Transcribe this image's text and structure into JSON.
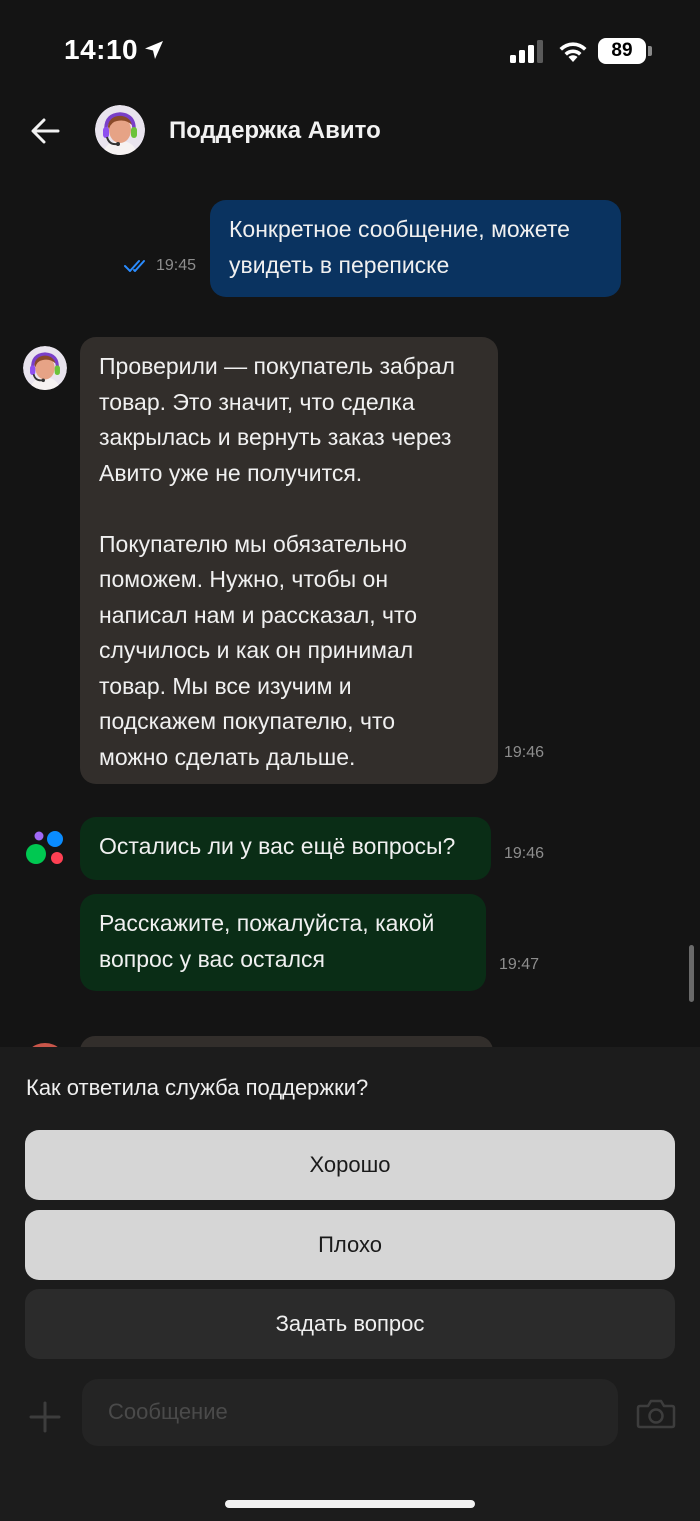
{
  "status_bar": {
    "time": "14:10",
    "battery": "89",
    "icons": [
      "location-arrow-icon",
      "signal-icon",
      "wifi-icon",
      "battery-icon"
    ]
  },
  "header": {
    "title": "Поддержка Авито",
    "back_icon": "arrow-left-icon",
    "avatar": "support-agent-avatar"
  },
  "messages": [
    {
      "direction": "outgoing",
      "text": "Конкретное сообщение, можете\nувидеть в переписке",
      "time": "19:45",
      "status": "read-double-check-icon"
    },
    {
      "direction": "incoming",
      "text": "Проверили — покупатель забрал\nтовар. Это значит, что сделка\nзакрылась и вернуть заказ через\nАвито уже не получится.\n\nПокупателю мы обязательно\nпоможем. Нужно, чтобы он\nнаписал нам и рассказал, что\nслучилось и как он принимал\nтовар. Мы все изучим и\nподскажем покупателю, что\nможно сделать дальше.",
      "time": "19:46"
    },
    {
      "direction": "incoming",
      "text": "Остались ли у вас ещё вопросы?",
      "time": "19:46"
    },
    {
      "direction": "incoming",
      "text": "Расскажите, пожалуйста, какой\nвопрос у вас остался",
      "time": "19:47"
    }
  ],
  "feedback": {
    "question": "Как ответила служба поддержки?",
    "options": [
      "Хорошо",
      "Плохо",
      "Задать вопрос"
    ]
  },
  "composer": {
    "placeholder": "Сообщение",
    "add_icon": "plus-icon",
    "camera_icon": "camera-icon"
  },
  "colors": {
    "background": "#141414",
    "outgoing_bubble": "#0a3360",
    "incoming_bubble": "#322e2b",
    "bot_bubble": "#0a2d16",
    "read_check": "#2a8cff"
  }
}
